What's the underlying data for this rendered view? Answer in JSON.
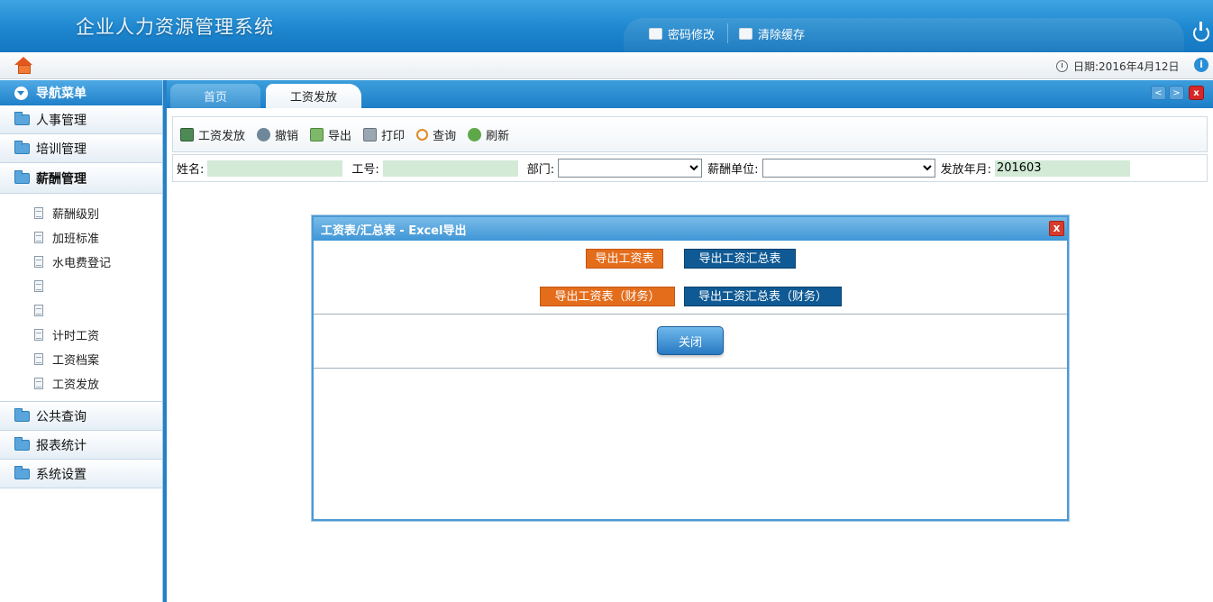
{
  "header": {
    "title": "企业人力资源管理系统",
    "tools": {
      "change_password": "密码修改",
      "clear_cache": "清除缓存"
    }
  },
  "info_bar": {
    "date": "日期:2016年4月12日"
  },
  "sidebar": {
    "title": "导航菜单",
    "groups_top": [
      {
        "label": "人事管理"
      },
      {
        "label": "培训管理"
      },
      {
        "label": "薪酬管理"
      }
    ],
    "sub_items": [
      {
        "label": "薪酬级别"
      },
      {
        "label": "加班标准"
      },
      {
        "label": "水电费登记"
      },
      {
        "label": ""
      },
      {
        "label": ""
      },
      {
        "label": "计时工资"
      },
      {
        "label": "工资档案"
      },
      {
        "label": "工资发放"
      }
    ],
    "groups_bottom": [
      {
        "label": "公共查询"
      },
      {
        "label": "报表统计"
      },
      {
        "label": "系统设置"
      }
    ]
  },
  "tabs": {
    "home": "首页",
    "wages": "工资发放",
    "prev": "<",
    "next": ">",
    "close_all": "x"
  },
  "toolbar": {
    "pay": "工资发放",
    "undo": "撤销",
    "export": "导出",
    "print": "打印",
    "query": "查询",
    "refresh": "刷新"
  },
  "filter": {
    "name_label": "姓名:",
    "name_value": "",
    "id_label": "工号:",
    "id_value": "",
    "dept_label": "部门:",
    "dept_value": "",
    "unit_label": "薪酬单位:",
    "unit_value": "",
    "month_label": "发放年月:",
    "month_value": "201603"
  },
  "dialog": {
    "title": "工资表/汇总表 - Excel导出",
    "close_x": "x",
    "export_wage": "导出工资表",
    "export_summary": "导出工资汇总表",
    "export_wage_finance": "导出工资表（财务）",
    "export_summary_finance": "导出工资汇总表（财务）",
    "close_button": "关闭"
  },
  "colors": {
    "header_blue": "#1d86cf",
    "orange_button": "#e46d1c",
    "dark_blue_button": "#0f5a94",
    "filter_input_green": "#d2ead6",
    "close_red": "#d62828"
  }
}
